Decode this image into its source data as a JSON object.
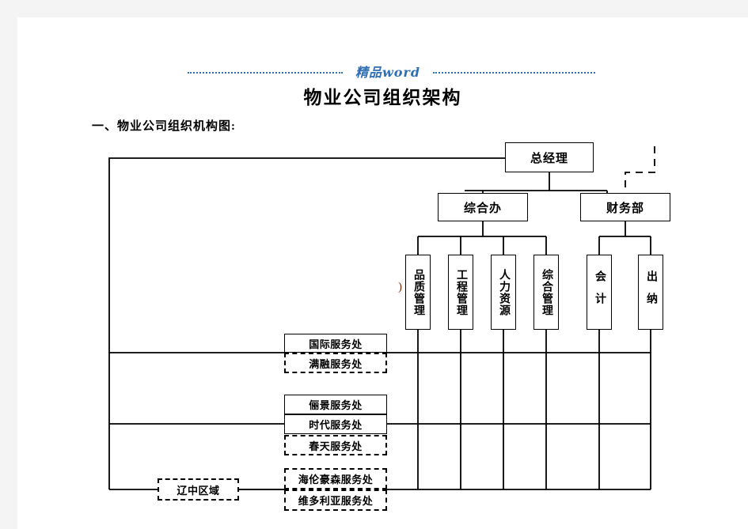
{
  "header": {
    "brand": "精品word",
    "title": "物业公司组织架构",
    "section": "一、物业公司组织机构图:",
    "brand_color": "#2f6fb5"
  },
  "chart_data": {
    "type": "diagram",
    "title": "物业公司组织架构",
    "nodes": [
      {
        "id": "gm",
        "label": "总经理",
        "orientation": "horizontal",
        "border": "solid",
        "level": 0
      },
      {
        "id": "zhb",
        "label": "综合办",
        "orientation": "horizontal",
        "border": "solid",
        "level": 1
      },
      {
        "id": "cwb",
        "label": "财务部",
        "orientation": "horizontal",
        "border": "solid",
        "level": 1
      },
      {
        "id": "pzgl",
        "label": "品质管理",
        "orientation": "vertical",
        "border": "solid",
        "level": 2
      },
      {
        "id": "gcgl",
        "label": "工程管理",
        "orientation": "vertical",
        "border": "solid",
        "level": 2
      },
      {
        "id": "rlzy",
        "label": "人力资源",
        "orientation": "vertical",
        "border": "solid",
        "level": 2
      },
      {
        "id": "zhgl",
        "label": "综合管理",
        "orientation": "vertical",
        "border": "solid",
        "level": 2
      },
      {
        "id": "kuaiji",
        "label": "会计",
        "orientation": "vertical",
        "border": "solid",
        "level": 2
      },
      {
        "id": "chuna",
        "label": "出纳",
        "orientation": "vertical",
        "border": "solid",
        "level": 2
      },
      {
        "id": "guoji",
        "label": "国际服务处",
        "orientation": "horizontal",
        "border": "solid",
        "level": 3
      },
      {
        "id": "manrong",
        "label": "满融服务处",
        "orientation": "horizontal",
        "border": "dashed",
        "level": 3
      },
      {
        "id": "lijing",
        "label": "俪景服务处",
        "orientation": "horizontal",
        "border": "solid",
        "level": 3
      },
      {
        "id": "shidai",
        "label": "时代服务处",
        "orientation": "horizontal",
        "border": "solid",
        "level": 3
      },
      {
        "id": "chuntian",
        "label": "春天服务处",
        "orientation": "horizontal",
        "border": "dashed",
        "level": 3
      },
      {
        "id": "liaozhong",
        "label": "辽中区域",
        "orientation": "horizontal",
        "border": "dashed",
        "level": 3
      },
      {
        "id": "hailun",
        "label": "海伦豪森服务处",
        "orientation": "horizontal",
        "border": "dashed",
        "level": 4
      },
      {
        "id": "weiduo",
        "label": "维多利亚服务处",
        "orientation": "horizontal",
        "border": "dashed",
        "level": 4
      }
    ],
    "edges": [
      {
        "from": "gm",
        "to": "zhb",
        "style": "solid"
      },
      {
        "from": "gm",
        "to": "cwb",
        "style": "solid"
      },
      {
        "from": "gm",
        "to": "cwb",
        "style": "dashed"
      },
      {
        "from": "zhb",
        "to": "pzgl",
        "style": "solid"
      },
      {
        "from": "zhb",
        "to": "gcgl",
        "style": "solid"
      },
      {
        "from": "zhb",
        "to": "rlzy",
        "style": "solid"
      },
      {
        "from": "zhb",
        "to": "zhgl",
        "style": "solid"
      },
      {
        "from": "cwb",
        "to": "kuaiji",
        "style": "solid"
      },
      {
        "from": "cwb",
        "to": "chuna",
        "style": "solid"
      },
      {
        "from": "gm",
        "to": "guoji",
        "style": "solid"
      },
      {
        "from": "gm",
        "to": "shidai",
        "style": "solid"
      },
      {
        "from": "gm",
        "to": "liaozhong",
        "style": "solid"
      },
      {
        "from": "liaozhong",
        "to": "hailun",
        "style": "solid"
      }
    ],
    "artifact_mark": ")"
  }
}
